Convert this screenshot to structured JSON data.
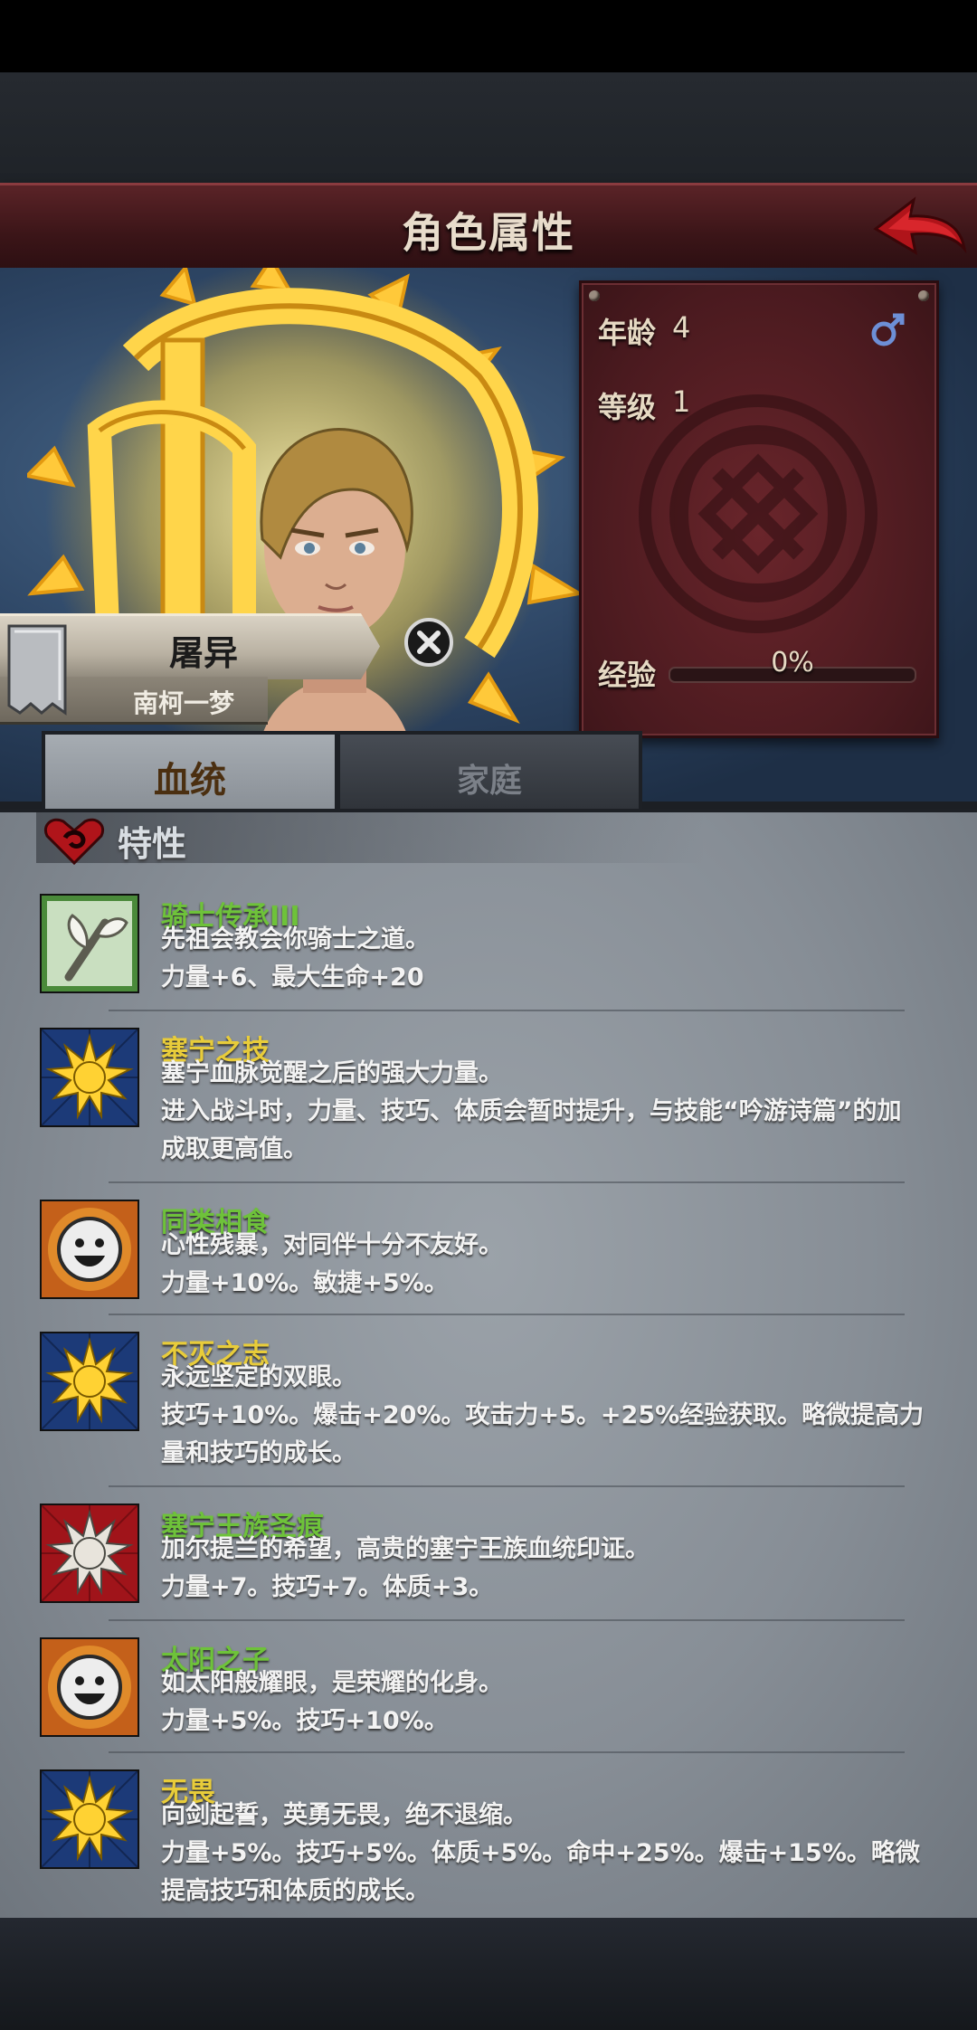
{
  "header": {
    "title": "角色属性"
  },
  "character": {
    "name": "屠异",
    "house": "南柯一梦",
    "age_label": "年龄",
    "age": "4",
    "level_label": "等级",
    "level": "1",
    "exp_label": "经验",
    "exp_percent": "0%",
    "exp_fraction": 0,
    "gender_symbol": "♂"
  },
  "tabs": [
    {
      "label": "血统",
      "active": true
    },
    {
      "label": "家庭",
      "active": false
    }
  ],
  "traits_section": {
    "title": "特性"
  },
  "traits": [
    {
      "name": "骑士传承III",
      "name_color": "#6ec23a",
      "icon": "knight-branch-icon",
      "lines": [
        "先祖会教会你骑士之道。",
        "力量+6、最大生命+20"
      ]
    },
    {
      "name": "塞宁之技",
      "name_color": "#e8cc3a",
      "icon": "sun-icon",
      "lines": [
        "塞宁血脉觉醒之后的强大力量。",
        "进入战斗时，力量、技巧、体质会暂时提升，与技能“吟游诗篇”的加",
        "成取更高值。"
      ]
    },
    {
      "name": "同类相食",
      "name_color": "#6ec23a",
      "icon": "smile-face-icon",
      "lines": [
        "心性残暴，对同伴十分不友好。",
        "力量+10%。敏捷+5%。"
      ]
    },
    {
      "name": "不灭之志",
      "name_color": "#e8cc3a",
      "icon": "sun-icon",
      "lines": [
        "永远坚定的双眼。",
        "技巧+10%。爆击+20%。攻击力+5。+25%经验获取。略微提高力",
        "量和技巧的成长。"
      ]
    },
    {
      "name": "塞宁王族圣痕",
      "name_color": "#6ec23a",
      "icon": "royal-sun-icon",
      "lines": [
        "加尔提兰的希望，高贵的塞宁王族血统印证。",
        "力量+7。技巧+7。体质+3。"
      ]
    },
    {
      "name": "太阳之子",
      "name_color": "#6ec23a",
      "icon": "smile-face-icon",
      "lines": [
        "如太阳般耀眼，是荣耀的化身。",
        "力量+5%。技巧+10%。"
      ]
    },
    {
      "name": "无畏",
      "name_color": "#e8cc3a",
      "icon": "sun-icon",
      "lines": [
        "向剑起誓，英勇无畏，绝不退缩。",
        "力量+5%。技巧+5%。体质+5%。命中+25%。爆击+15%。略微",
        "提高技巧和体质的成长。"
      ]
    }
  ]
}
